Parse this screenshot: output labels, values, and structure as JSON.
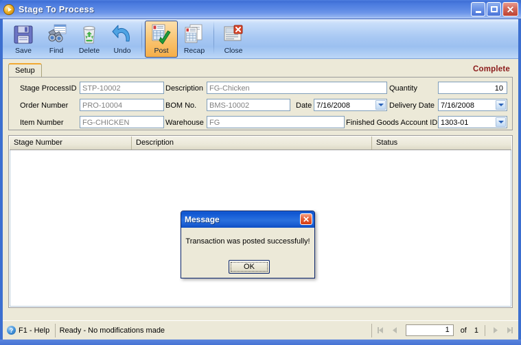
{
  "window": {
    "title": "Stage To Process",
    "icon": "process-circle-icon",
    "minimize_label": "_",
    "maximize_label": "□",
    "close_label": "✕"
  },
  "toolbar": {
    "items": [
      {
        "label": "Save",
        "icon": "floppy-disk-icon",
        "active": false
      },
      {
        "label": "Find",
        "icon": "binoculars-icon",
        "active": false
      },
      {
        "label": "Delete",
        "icon": "recycle-bin-icon",
        "active": false
      },
      {
        "label": "Undo",
        "icon": "undo-arrow-icon",
        "active": false
      },
      {
        "label": "Post",
        "icon": "post-check-icon",
        "active": true
      },
      {
        "label": "Recap",
        "icon": "recap-pages-icon",
        "active": false
      },
      {
        "label": "Close",
        "icon": "close-document-icon",
        "active": false
      }
    ]
  },
  "tabs": {
    "items": [
      {
        "label": "Setup",
        "selected": true
      }
    ]
  },
  "status_flag": {
    "label": "Complete",
    "color": "#8b1a1a"
  },
  "form": {
    "fields": [
      {
        "label": "Stage ProcessID",
        "value": "STP-10002",
        "type": "textbox"
      },
      {
        "label": "Description",
        "value": "FG-Chicken",
        "type": "textbox"
      },
      {
        "label": "Quantity",
        "value": "10",
        "type": "number"
      },
      {
        "label": "Order Number",
        "value": "PRO-10004",
        "type": "textbox"
      },
      {
        "label": "BOM No.",
        "value": "BMS-10002",
        "type": "textbox"
      },
      {
        "label": "Date",
        "value": "7/16/2008",
        "type": "combo"
      },
      {
        "label": "Delivery Date",
        "value": "7/16/2008",
        "type": "combo"
      },
      {
        "label": "Item Number",
        "value": "FG-CHICKEN",
        "type": "textbox"
      },
      {
        "label": "Warehouse",
        "value": "FG",
        "type": "textbox"
      },
      {
        "label": "Finished Goods Account ID",
        "value": "1303-01",
        "type": "combo"
      }
    ]
  },
  "grid": {
    "columns": [
      {
        "label": "Stage Number"
      },
      {
        "label": "Description"
      },
      {
        "label": "Status"
      }
    ],
    "rows": []
  },
  "dialog": {
    "title": "Message",
    "message": "Transaction was posted successfully!",
    "ok_label": "OK",
    "close_label": "✕"
  },
  "statusbar": {
    "help_icon": "question-mark-icon",
    "help_label": "F1 - Help",
    "status_message": "Ready - No modifications made",
    "nav": {
      "first_label": "⏮",
      "prev_label": "◀",
      "current_page": "1",
      "of_label": "of",
      "total_pages": "1",
      "next_label": "▶",
      "last_label": "⏭"
    }
  }
}
